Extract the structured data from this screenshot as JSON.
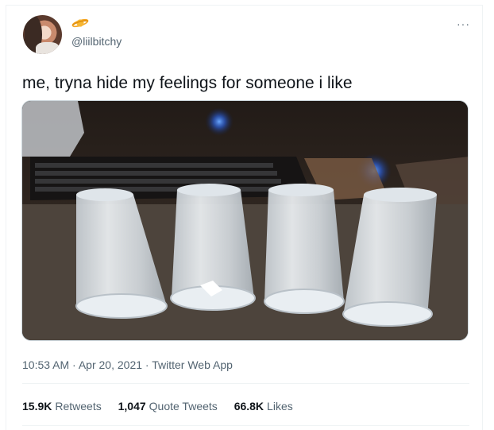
{
  "tweet": {
    "handle": "@liilbitchy",
    "handle_badge_icon": "saturn-planet-icon",
    "more_icon": "more-dots-icon",
    "text": "me, tryna hide my feelings for someone i like",
    "time": "10:53 AM",
    "date": "Apr 20, 2021",
    "source": "Twitter Web App",
    "separator": "·"
  },
  "stats": {
    "retweets_count": "15.9K",
    "retweets_label": "Retweets",
    "quote_count": "1,047",
    "quote_label": "Quote Tweets",
    "likes_count": "66.8K",
    "likes_label": "Likes"
  },
  "colors": {
    "text_primary": "#0f1419",
    "text_secondary": "#536471",
    "border": "#eff3f4",
    "badge": "#f5a623"
  }
}
